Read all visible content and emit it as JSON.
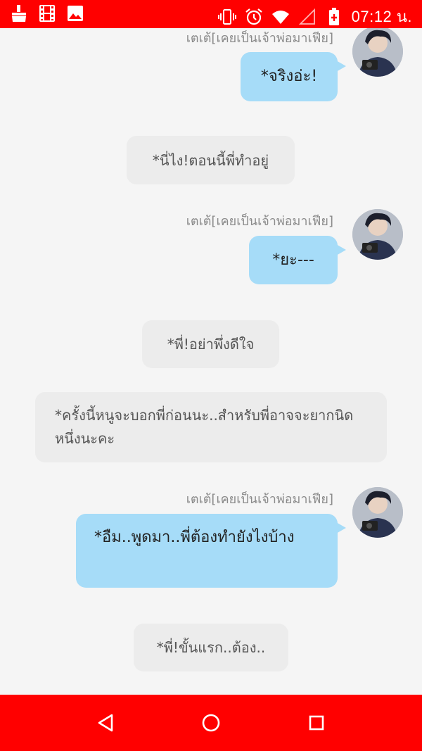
{
  "status_bar": {
    "time": "07:12 น.",
    "left_icons": [
      "broom-icon",
      "film-icon",
      "image-icon"
    ],
    "right_icons": [
      "vibrate-icon",
      "alarm-icon",
      "wifi-icon",
      "signal-icon",
      "battery-charging-icon"
    ]
  },
  "chat": {
    "sender_name": "เตเต้[เคยเป็นเจ้าพ่อมาเฟีย]",
    "messages": [
      {
        "type": "sent",
        "text": "*จริงอ่ะ!"
      },
      {
        "type": "narration",
        "text": "*นี่ไง!ตอนนี้พี่ทำอยู่"
      },
      {
        "type": "sent",
        "text": "*ยะ---"
      },
      {
        "type": "narration",
        "text": "*พี่!อย่าพึ่งดีใจ"
      },
      {
        "type": "narration",
        "text": "*ครั้งนี้หนูจะบอกพี่ก่อนนะ..สำหรับพี่อาจจะยากนิดหนึ่งนะคะ"
      },
      {
        "type": "sent",
        "text": "*อืม..พูดมา..พี่ต้องทำยังไงบ้าง"
      },
      {
        "type": "narration",
        "text": "*พี่!ขั้นแรก..ต้อง.."
      }
    ]
  },
  "nav_bar": {
    "icons": [
      "back-icon",
      "home-icon",
      "recents-icon"
    ]
  },
  "colors": {
    "status_bar": "#ff0000",
    "nav_bar": "#ff0000",
    "sent_bubble": "#a6dcf8",
    "narration_bubble": "#ececec",
    "background": "#f5f5f5"
  }
}
